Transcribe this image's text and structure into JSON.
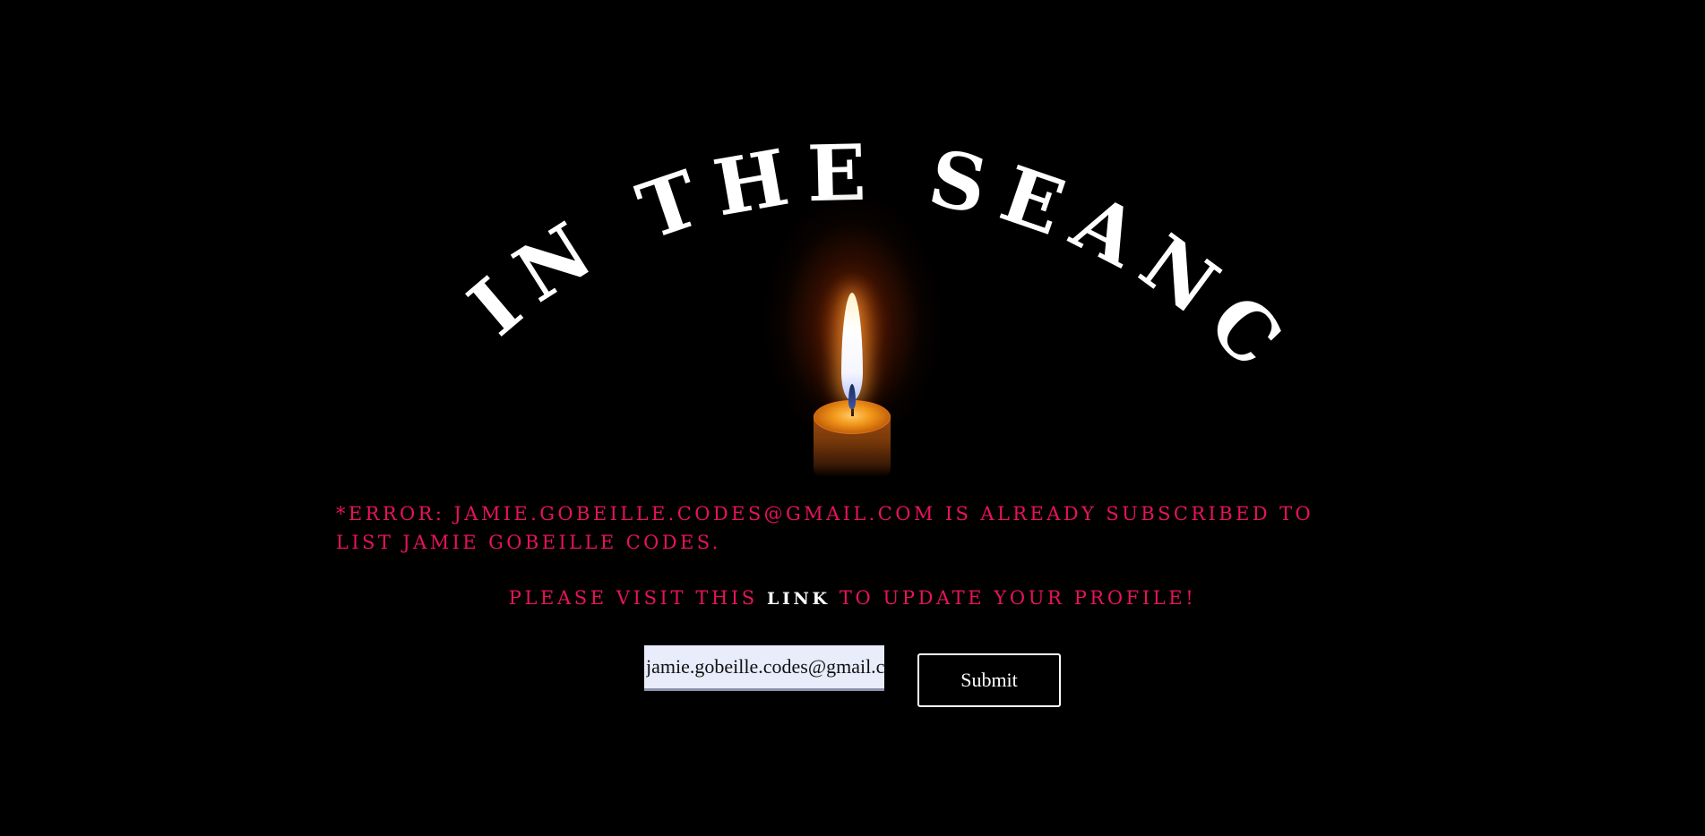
{
  "heading": {
    "title": "JOIN THE SEANCE"
  },
  "candle": {
    "icon": "candle-icon",
    "flame_color": "#ffffff",
    "glow_color": "#be460a",
    "wax_color": "#f29a1c"
  },
  "message": {
    "error": "*Error: jamie.gobeille.codes@gmail.com is already subscribed to list Jamie Gobeille Codes.",
    "visit_prefix": "Please visit this",
    "link_text": "link",
    "visit_suffix": "to update your profile!"
  },
  "form": {
    "email_value": "jamie.gobeille.codes@gmail.com",
    "submit_label": "Submit"
  },
  "colors": {
    "background": "#000000",
    "accent": "#e8135a",
    "text": "#ffffff"
  }
}
